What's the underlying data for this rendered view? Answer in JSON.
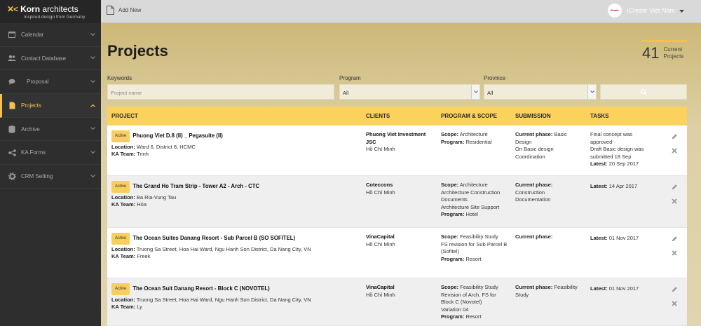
{
  "sidebar": {
    "logo": {
      "mark": "✕<",
      "name_bold": "Korn",
      "name_light": " architects",
      "tagline": "Inspired design from Germany"
    },
    "items": [
      {
        "label": "Calendar",
        "icon": "calendar-icon"
      },
      {
        "label": "Contact Database",
        "icon": "users-icon"
      },
      {
        "label": "Proposal",
        "icon": "chat-icon"
      },
      {
        "label": "Projects",
        "icon": "document-icon",
        "active": true
      },
      {
        "label": "Archive",
        "icon": "database-icon"
      },
      {
        "label": "KA Forms",
        "icon": "share-icon"
      },
      {
        "label": "CRM Setting",
        "icon": "gear-icon"
      }
    ]
  },
  "topbar": {
    "add_new": "Add New",
    "user_name": "iCreate Việt Nam",
    "avatar_text": "iCreate"
  },
  "page": {
    "title": "Projects",
    "count": "41",
    "count_label_1": "Current",
    "count_label_2": "Projects"
  },
  "filters": {
    "keywords_label": "Keywords",
    "keywords_placeholder": "Project name",
    "program_label": "Program",
    "program_value": "All",
    "province_label": "Province",
    "province_value": "All"
  },
  "table": {
    "headers": {
      "project": "PROJECT",
      "clients": "CLIENTS",
      "program": "PROGRAM & SCOPE",
      "submission": "SUBMISSION",
      "tasks": "TASKS"
    },
    "labels": {
      "location": "Location:",
      "team": "KA Team:",
      "scope": "Scope:",
      "program": "Program:",
      "phase": "Current phase:",
      "latest": "Latest:"
    },
    "rows": [
      {
        "status": "Active",
        "title": "Phuong Viet D.8 (II) _ Pegasuite (II)",
        "location": "Ward 6, District 8, HCMC",
        "team": "Trinh",
        "client_l1": "Phuong Viet Investment",
        "client_l2": "JSC",
        "city": "Hồ Chí Minh",
        "scope_l1": "Architecture",
        "scope_l2": "",
        "scope_l3": "",
        "scope_l4": "",
        "program": "Residential",
        "phase_l1": "Basic",
        "phase_l2": "Design",
        "phase_l3": "On Basic design",
        "phase_l4": "Coordination",
        "task_l1": "Final concept was",
        "task_l2": "approved",
        "task_l3": "Draft Basic design was",
        "task_l4": "submitted 18 Sep",
        "latest": "20 Sep 2017"
      },
      {
        "status": "Active",
        "title": "The Grand Ho Tram Strip - Tower A2 - Arch - CTC",
        "location": "Ba Ria-Vung Tau",
        "team": "Hóa",
        "client_l1": "Coteccons",
        "client_l2": "",
        "city": "Hồ Chí Minh",
        "scope_l1": "Architecture",
        "scope_l2": "Architecture Construction",
        "scope_l3": "Documents",
        "scope_l4": "Architecture Site Support",
        "program": "Hotel",
        "phase_l1": "",
        "phase_l2": "Construction",
        "phase_l3": "Documentation",
        "phase_l4": "",
        "task_l1": "",
        "task_l2": "",
        "task_l3": "",
        "task_l4": "",
        "latest": "14 Apr 2017"
      },
      {
        "status": "Active",
        "title": "The Ocean Suites Danang Resort - Sub Parcel B (SO SOFITEL)",
        "location": "Truong Sa Street, Hoa Hai Ward, Ngu Hanh Son District, Da Nang City, VN",
        "team": "Freek",
        "client_l1": "VinaCapital",
        "client_l2": "",
        "city": "Hồ Chí Minh",
        "scope_l1": "Feasibility Study",
        "scope_l2": "FS revision for Sub Parcel B",
        "scope_l3": "(Sofitel)",
        "scope_l4": "",
        "program": "Resort",
        "phase_l1": "",
        "phase_l2": "",
        "phase_l3": "",
        "phase_l4": "",
        "task_l1": "",
        "task_l2": "",
        "task_l3": "",
        "task_l4": "",
        "latest": "01 Nov 2017"
      },
      {
        "status": "Active",
        "title": "The Ocean Suit Danang Resort - Block C (NOVOTEL)",
        "location": "Truong Sa Street, Hoa Hai Ward, Ngu Hanh Son District, Da Nang City, VN",
        "team": "Ly",
        "client_l1": "VinaCapital",
        "client_l2": "",
        "city": "Hồ Chí Minh",
        "scope_l1": "Feasibility Study",
        "scope_l2": "Revision of Arch. FS for",
        "scope_l3": "Block C (Novotel)",
        "scope_l4": "Variation 04",
        "program": "Resort",
        "phase_l1": "Feasibility",
        "phase_l2": "Study",
        "phase_l3": "",
        "phase_l4": "",
        "task_l1": "",
        "task_l2": "",
        "task_l3": "",
        "task_l4": "",
        "latest": "01 Nov 2017"
      }
    ]
  },
  "colors": {
    "accent": "#f2c14e",
    "header": "#fbd25c",
    "sidebar": "#2e2e2e"
  }
}
